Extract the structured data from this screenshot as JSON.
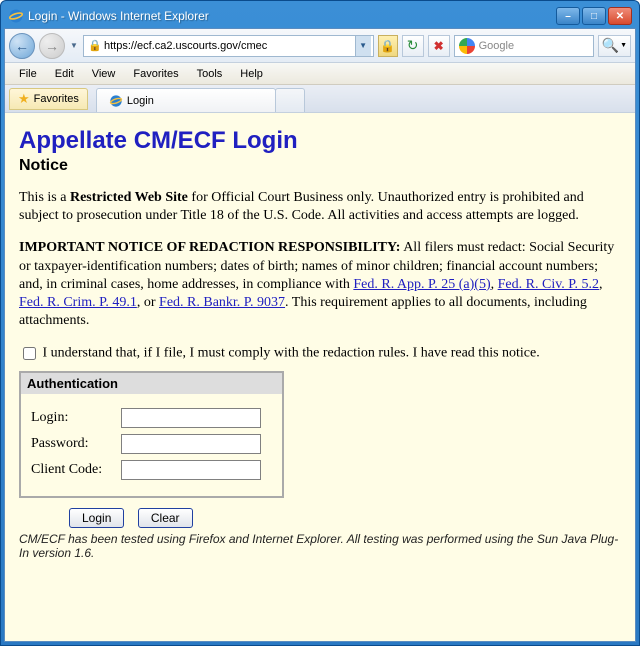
{
  "window": {
    "title": "Login - Windows Internet Explorer"
  },
  "address": {
    "url": "https://ecf.ca2.uscourts.gov/cmec"
  },
  "search": {
    "placeholder": "Google"
  },
  "menu": {
    "file": "File",
    "edit": "Edit",
    "view": "View",
    "favorites": "Favorites",
    "tools": "Tools",
    "help": "Help"
  },
  "tabbar": {
    "favorites": "Favorites",
    "tab1": "Login"
  },
  "page": {
    "title": "Appellate CM/ECF Login",
    "subtitle": "Notice",
    "notice1_a": "This is a ",
    "notice1_b": "Restricted Web Site",
    "notice1_c": " for Official Court Business only. Unauthorized entry is prohibited and subject to prosecution under Title 18 of the U.S. Code. All activities and access attempts are logged.",
    "redact_bold": "IMPORTANT NOTICE OF REDACTION RESPONSIBILITY:",
    "redact_body": " All filers must redact: Social Security or taxpayer-identification numbers; dates of birth; names of minor children; financial account numbers; and, in criminal cases, home addresses, in compliance with ",
    "link1": "Fed. R. App. P. 25 (a)(5)",
    "sep1": ", ",
    "link2": "Fed. R. Civ. P. 5.2",
    "sep2": ", ",
    "link3": "Fed. R. Crim. P. 49.1",
    "sep3": ", or ",
    "link4": "Fed. R. Bankr. P. 9037",
    "redact_tail": ". This requirement applies to all documents, including attachments.",
    "chk_label": "I understand that, if I file, I must comply with the redaction rules. I have read this notice.",
    "auth": {
      "header": "Authentication",
      "login_label": "Login:",
      "password_label": "Password:",
      "client_label": "Client Code:"
    },
    "buttons": {
      "login": "Login",
      "clear": "Clear"
    },
    "footer": "CM/ECF has been tested using Firefox and Internet Explorer. All testing was performed using the Sun Java Plug-In version 1.6."
  }
}
